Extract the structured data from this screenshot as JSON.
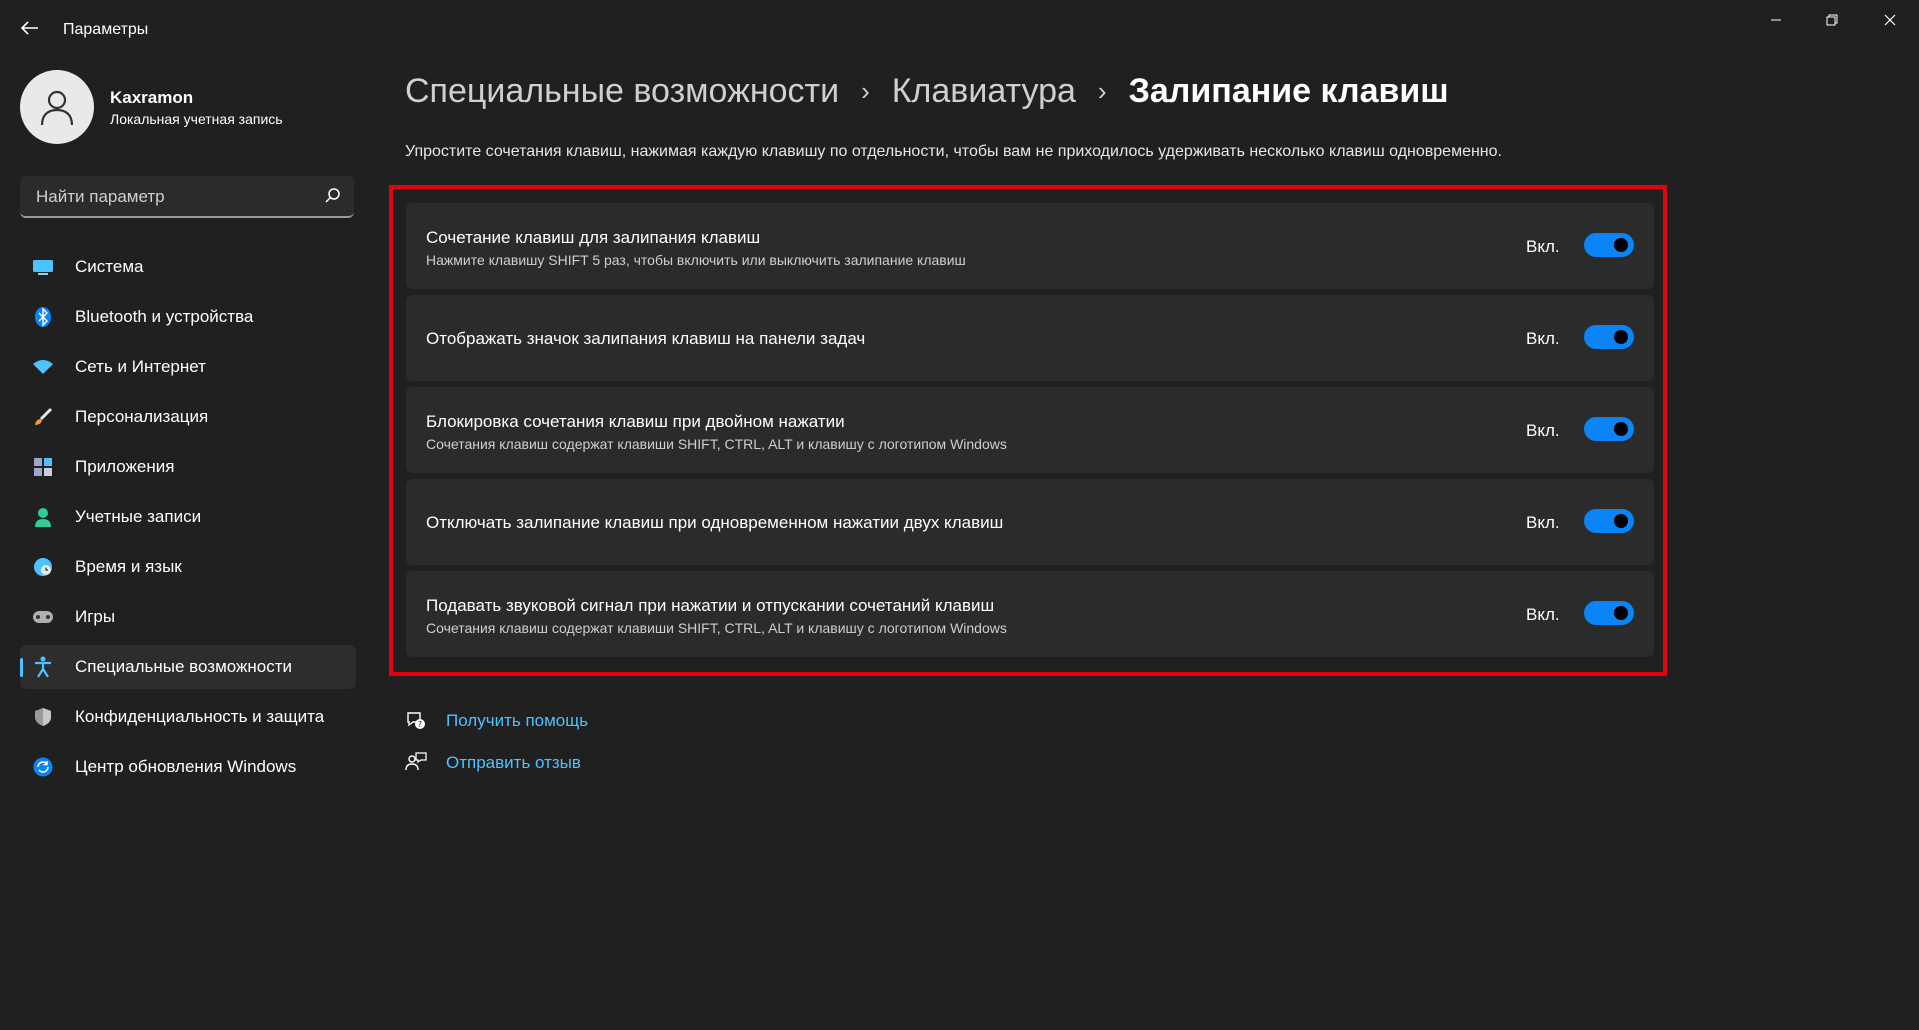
{
  "window": {
    "title": "Параметры",
    "minimize_glyph": "—",
    "maximize_glyph": "❐",
    "close_glyph": "✕"
  },
  "user": {
    "name": "Kaxramon",
    "account_type": "Локальная учетная запись"
  },
  "search": {
    "placeholder": "Найти параметр"
  },
  "sidebar": {
    "items": [
      {
        "label": "Система",
        "icon": "monitor-icon",
        "color": "#4cc2ff"
      },
      {
        "label": "Bluetooth и устройства",
        "icon": "bluetooth-icon",
        "color": "#0a84f7"
      },
      {
        "label": "Сеть и Интернет",
        "icon": "wifi-icon",
        "color": "#4cc2ff"
      },
      {
        "label": "Персонализация",
        "icon": "brush-icon",
        "color": "#f0a030"
      },
      {
        "label": "Приложения",
        "icon": "apps-icon",
        "color": "#9aa7c7"
      },
      {
        "label": "Учетные записи",
        "icon": "person-icon",
        "color": "#2ecc9a"
      },
      {
        "label": "Время и язык",
        "icon": "globe-clock-icon",
        "color": "#4cc2ff"
      },
      {
        "label": "Игры",
        "icon": "gamepad-icon",
        "color": "#b0b0b0"
      },
      {
        "label": "Специальные возможности",
        "icon": "accessibility-icon",
        "color": "#4cc2ff",
        "active": true
      },
      {
        "label": "Конфиденциальность и защита",
        "icon": "shield-icon",
        "color": "#9a9a9a"
      },
      {
        "label": "Центр обновления Windows",
        "icon": "update-icon",
        "color": "#0a84f7"
      }
    ]
  },
  "breadcrumb": {
    "level1": "Специальные возможности",
    "level2": "Клавиатура",
    "current": "Залипание клавиш",
    "separator": "›"
  },
  "description": "Упростите сочетания клавиш, нажимая каждую клавишу по отдельности, чтобы вам не приходилось удерживать несколько клавиш одновременно.",
  "settings": [
    {
      "title": "Сочетание клавиш для залипания клавиш",
      "subtitle": "Нажмите клавишу SHIFT 5 раз, чтобы включить или выключить залипание клавиш",
      "state": "Вкл.",
      "on": true
    },
    {
      "title": "Отображать значок залипания клавиш на панели задач",
      "subtitle": "",
      "state": "Вкл.",
      "on": true
    },
    {
      "title": "Блокировка сочетания клавиш при двойном нажатии",
      "subtitle": "Сочетания клавиш содержат клавиши SHIFT, CTRL, ALT и клавишу с логотипом Windows",
      "state": "Вкл.",
      "on": true
    },
    {
      "title": "Отключать залипание клавиш при одновременном нажатии двух клавиш",
      "subtitle": "",
      "state": "Вкл.",
      "on": true
    },
    {
      "title": "Подавать звуковой сигнал при нажатии и отпускании сочетаний клавиш",
      "subtitle": "Сочетания клавиш содержат клавиши SHIFT, CTRL, ALT и клавишу с логотипом Windows",
      "state": "Вкл.",
      "on": true
    }
  ],
  "links": {
    "help": "Получить помощь",
    "feedback": "Отправить отзыв"
  },
  "colors": {
    "accent": "#0a84f7",
    "link": "#4cc2ff",
    "highlight_border": "#e3000f",
    "background": "#202020",
    "card": "#2b2b2b"
  }
}
